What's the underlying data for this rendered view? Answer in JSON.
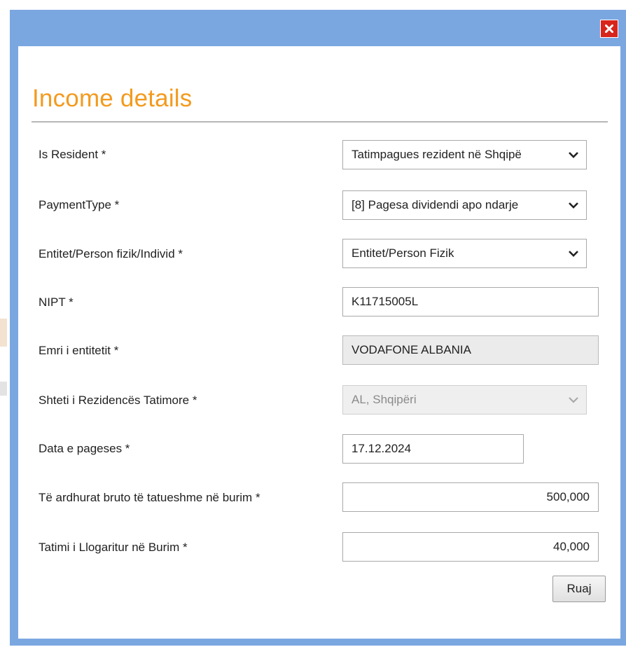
{
  "dialog": {
    "title": "Income details",
    "close_symbol": "×",
    "save_label": "Ruaj"
  },
  "fields": {
    "is_resident": {
      "label": "Is Resident *",
      "value": "Tatimpagues rezident në Shqipë"
    },
    "payment_type": {
      "label": "PaymentType *",
      "value": "[8] Pagesa dividendi apo ndarje"
    },
    "entity_type": {
      "label": "Entitet/Person fizik/Individ *",
      "value": "Entitet/Person Fizik"
    },
    "nipt": {
      "label": "NIPT *",
      "value": "K11715005L"
    },
    "entity_name": {
      "label": "Emri i entitetit *",
      "value": "VODAFONE ALBANIA"
    },
    "residence_country": {
      "label": "Shteti i Rezidencës Tatimore *",
      "value": "AL, Shqipëri"
    },
    "payment_date": {
      "label": "Data e pageses *",
      "value": "17.12.2024"
    },
    "gross_income": {
      "label": "Të ardhurat bruto të tatueshme në burim *",
      "value": "500,000"
    },
    "withheld_tax": {
      "label": "Tatimi i Llogaritur në Burim *",
      "value": "40,000"
    }
  },
  "colors": {
    "frame": "#7ba7e1",
    "heading": "#f39a1e",
    "close": "#d8251c"
  },
  "icons": {
    "close": "close-icon",
    "dropdown": "chevron-down-icon"
  }
}
